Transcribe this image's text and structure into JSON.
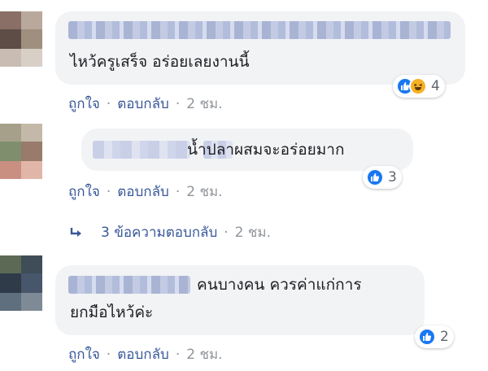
{
  "comments": [
    {
      "text_lines": [
        "ไหว้ครูเสร็จ อร่อยเลยงานนี้"
      ],
      "reaction_count": "4",
      "actions": {
        "like": "ถูกใจ",
        "reply": "ตอบกลับ",
        "time": "2 ชม."
      }
    },
    {
      "text_lines": [
        "น้ำปลาผสมจะอร่อยมาก"
      ],
      "reaction_count": "3",
      "actions": {
        "like": "ถูกใจ",
        "reply": "ตอบกลับ",
        "time": "2 ชม."
      }
    },
    {
      "text_lines": [
        "คนบางคน ควรค่าแก่การ",
        "ยกมือไหว้ค่ะ"
      ],
      "reaction_count": "2",
      "actions": {
        "like": "ถูกใจ",
        "reply": "ตอบกลับ",
        "time": "2 ชม."
      }
    }
  ],
  "replies_link": {
    "label": "3 ข้อความตอบกลับ",
    "time": "2 ชม."
  },
  "separator": "·",
  "icons": {
    "like": "thumbs-up-icon",
    "haha": "laughing-face-icon",
    "reply_arrow": "reply-arrow-icon"
  },
  "colors": {
    "link": "#385898",
    "bubble": "#f2f3f5",
    "like_blue": "#1877f2",
    "haha_yellow": "#f7b125"
  }
}
